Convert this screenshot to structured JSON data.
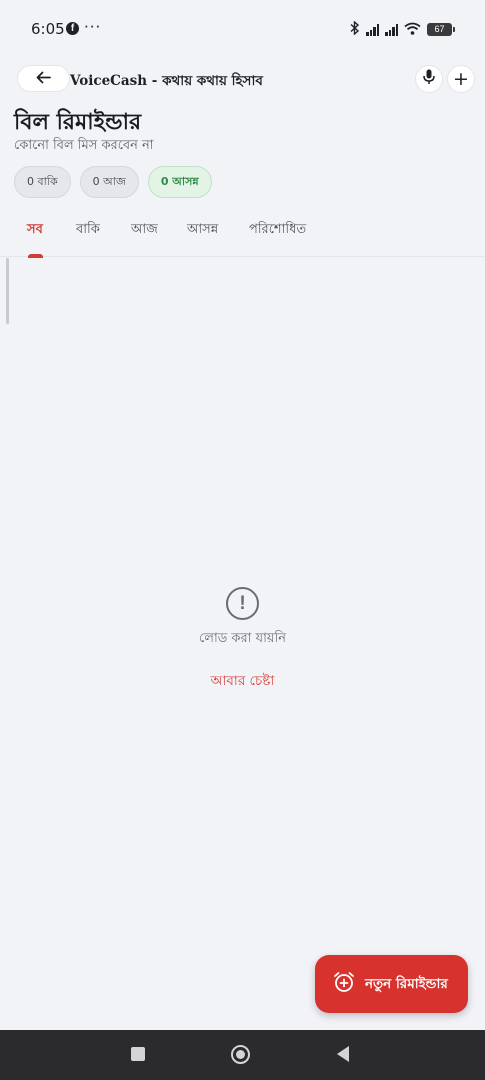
{
  "status_bar": {
    "time": "6:05",
    "facebook_icon": "facebook-icon",
    "more_indicator": "···",
    "battery": "67",
    "icons": [
      "bluetooth-icon",
      "signal-icon",
      "signal-icon",
      "wifi-icon",
      "battery-icon"
    ]
  },
  "app_bar": {
    "back_icon": "arrow-left-icon",
    "title": "VoiceCash - কথায় কথায় হিসাব",
    "mic_icon": "mic-icon",
    "add_label": "+"
  },
  "header": {
    "title": "বিল রিমাইন্ডার",
    "subtitle": "কোনো বিল মিস করবেন না"
  },
  "chips": [
    {
      "label": "0 বাকি"
    },
    {
      "label": "0 আজ"
    },
    {
      "label": "0 আসন্ন"
    }
  ],
  "tabs": [
    {
      "label": "সব",
      "active": true
    },
    {
      "label": "বাকি"
    },
    {
      "label": "আজ"
    },
    {
      "label": "আসন্ন"
    },
    {
      "label": "পরিশোধিত"
    }
  ],
  "error_state": {
    "icon_label": "!",
    "message": "লোড করা যায়নি",
    "retry": "আবার চেষ্টা"
  },
  "fab": {
    "icon": "alarm-add-icon",
    "label": "নতুন রিমাইন্ডার"
  },
  "colors": {
    "accent": "#d33b37",
    "fab": "#d7322e",
    "upcoming": "#2e8b45",
    "background": "#f2f3f7"
  }
}
